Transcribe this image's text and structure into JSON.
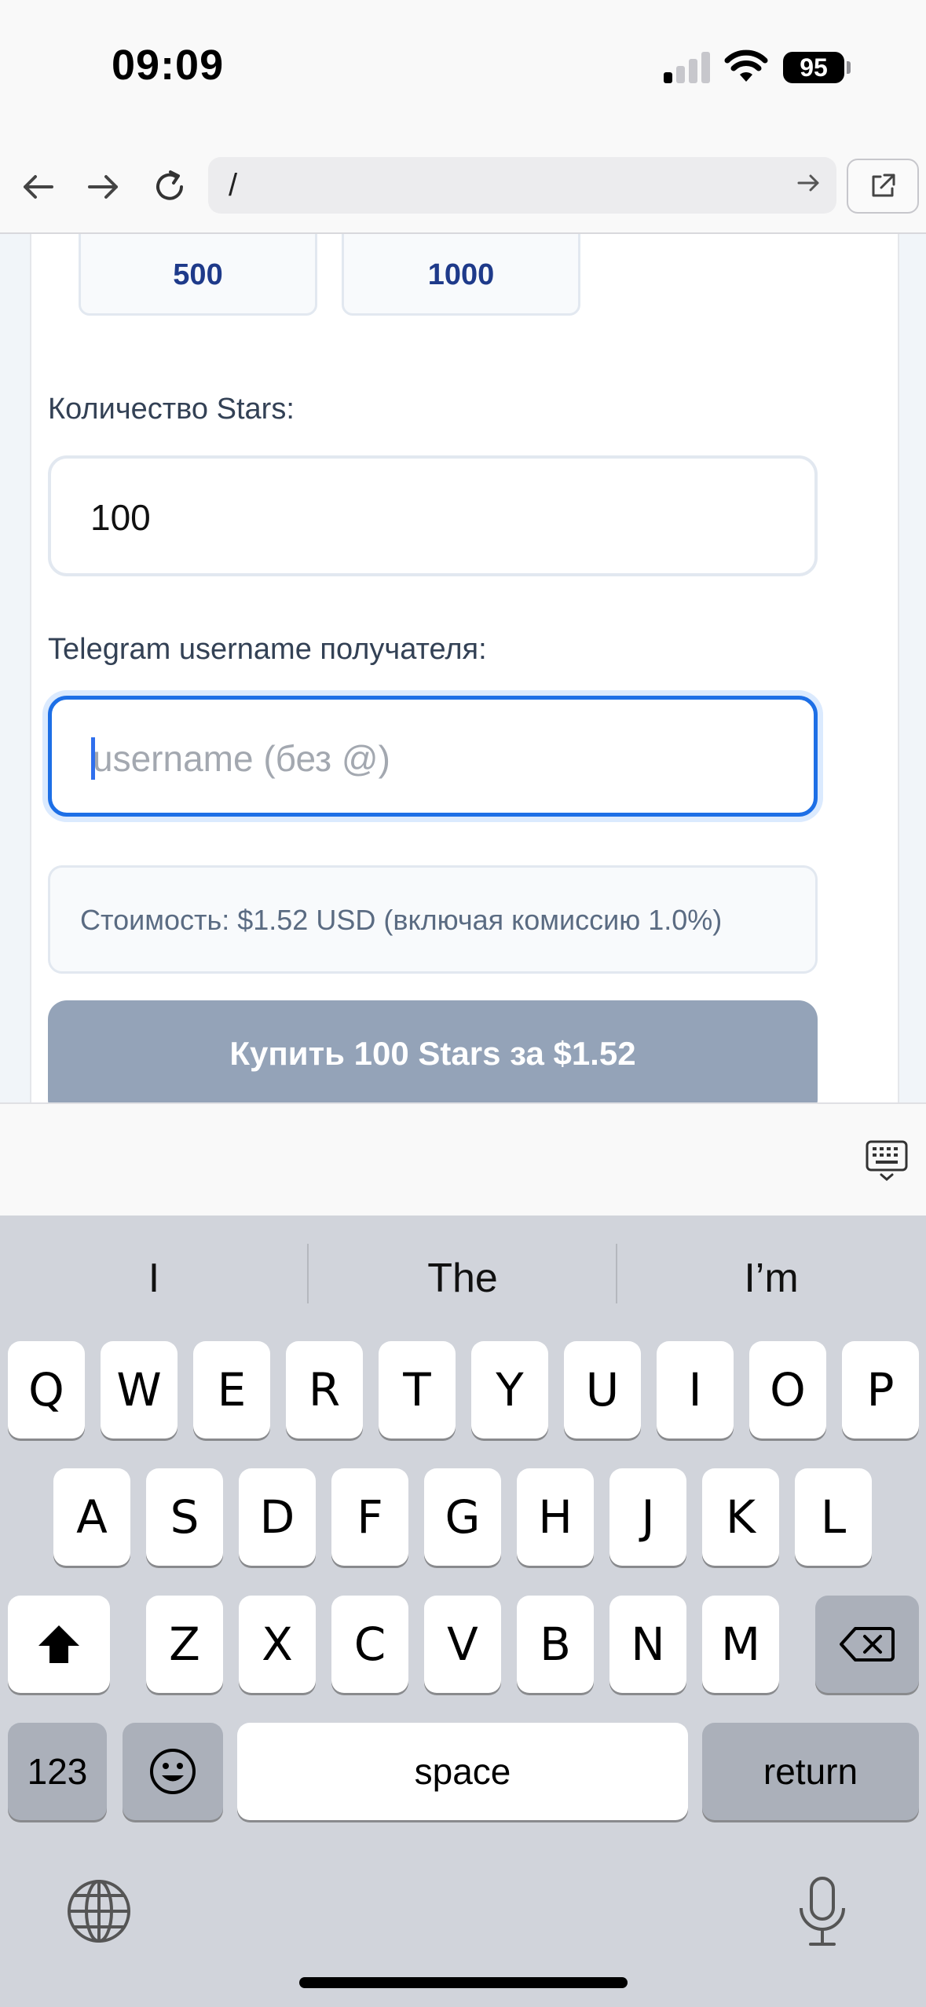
{
  "status_bar": {
    "time": "09:09",
    "battery": "95"
  },
  "browser": {
    "url": "/"
  },
  "form": {
    "presets": [
      "500",
      "1000"
    ],
    "quantity_label": "Количество Stars:",
    "quantity_value": "100",
    "username_label": "Telegram username получателя:",
    "username_placeholder": "username (без @)",
    "cost_text": "Стоимость: $1.52 USD (включая комиссию 1.0%)",
    "buy_button": "Купить 100 Stars за $1.52"
  },
  "keyboard": {
    "suggestions": [
      "I",
      "The",
      "I’m"
    ],
    "row1": [
      "Q",
      "W",
      "E",
      "R",
      "T",
      "Y",
      "U",
      "I",
      "O",
      "P"
    ],
    "row2": [
      "A",
      "S",
      "D",
      "F",
      "G",
      "H",
      "J",
      "K",
      "L"
    ],
    "row3": [
      "Z",
      "X",
      "C",
      "V",
      "B",
      "N",
      "M"
    ],
    "numbers_key": "123",
    "space_key": "space",
    "return_key": "return"
  }
}
